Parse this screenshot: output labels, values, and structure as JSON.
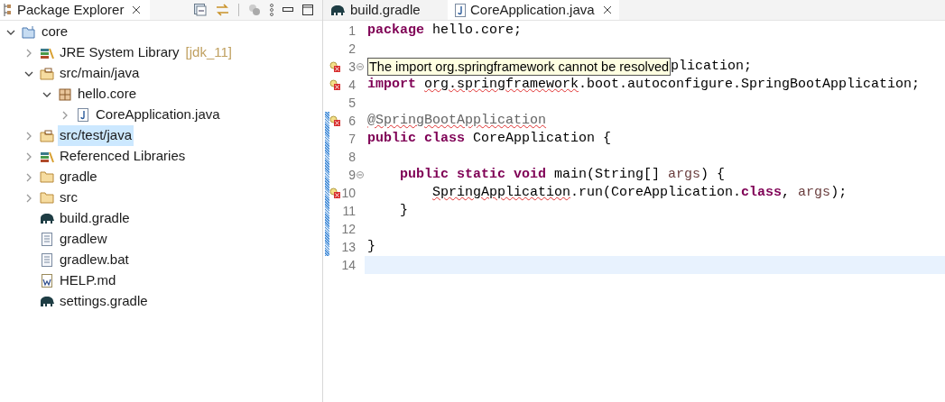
{
  "explorer": {
    "title": "Package Explorer",
    "tree": [
      {
        "label": "core",
        "kind": "project",
        "expanded": true,
        "selected": false,
        "children": [
          {
            "label": "JRE System Library",
            "decoration": "[jdk_11]",
            "kind": "library",
            "expanded": false,
            "selected": false
          },
          {
            "label": "src/main/java",
            "kind": "source-folder",
            "expanded": true,
            "selected": false,
            "children": [
              {
                "label": "hello.core",
                "kind": "package",
                "expanded": true,
                "selected": false,
                "children": [
                  {
                    "label": "CoreApplication.java",
                    "kind": "java-file",
                    "expanded": false,
                    "selected": false
                  }
                ]
              }
            ]
          },
          {
            "label": "src/test/java",
            "kind": "source-folder",
            "expanded": false,
            "selected": true
          },
          {
            "label": "Referenced Libraries",
            "kind": "library",
            "expanded": false,
            "selected": false
          },
          {
            "label": "gradle",
            "kind": "folder",
            "expanded": false,
            "selected": false
          },
          {
            "label": "src",
            "kind": "folder",
            "expanded": false,
            "selected": false
          },
          {
            "label": "build.gradle",
            "kind": "gradle-file",
            "selected": false
          },
          {
            "label": "gradlew",
            "kind": "text-file",
            "selected": false
          },
          {
            "label": "gradlew.bat",
            "kind": "text-file",
            "selected": false
          },
          {
            "label": "HELP.md",
            "kind": "word-file",
            "selected": false
          },
          {
            "label": "settings.gradle",
            "kind": "gradle-file",
            "selected": false
          }
        ]
      }
    ]
  },
  "editor": {
    "tabs": [
      {
        "label": "build.gradle",
        "kind": "gradle-file",
        "selected": false
      },
      {
        "label": "CoreApplication.java",
        "kind": "java-file",
        "selected": true
      }
    ],
    "lines": [
      {
        "number": "1",
        "error": false,
        "fold": false,
        "changed": false,
        "current": false,
        "tokens": [
          {
            "kind": "keyword",
            "text": "package"
          },
          {
            "kind": "text",
            "text": " hello.core;"
          }
        ]
      },
      {
        "number": "2",
        "error": false,
        "fold": false,
        "changed": false,
        "current": false
      },
      {
        "number": "3",
        "error": true,
        "fold": true,
        "changed": false,
        "current": false,
        "tooltip": "The import org.springframework cannot be resolved",
        "tokens": [
          {
            "kind": "text",
            "text": "plication;"
          }
        ]
      },
      {
        "number": "4",
        "error": true,
        "fold": false,
        "changed": false,
        "current": false,
        "tokens": [
          {
            "kind": "keyword",
            "text": "import"
          },
          {
            "kind": "text",
            "text": " org.springframework",
            "squiggle": true
          },
          {
            "kind": "text",
            "text": ".boot.autoconfigure.SpringBootApplication;"
          }
        ]
      },
      {
        "number": "5",
        "error": false,
        "fold": false,
        "changed": false,
        "current": false
      },
      {
        "number": "6",
        "error": true,
        "fold": false,
        "changed": true,
        "current": false,
        "tokens": [
          {
            "kind": "annotation",
            "text": "@SpringBootApplication",
            "squiggle": true
          }
        ]
      },
      {
        "number": "7",
        "error": false,
        "fold": false,
        "changed": true,
        "current": false,
        "tokens": [
          {
            "kind": "keyword",
            "text": "public class"
          },
          {
            "kind": "text",
            "text": " CoreApplication {"
          }
        ]
      },
      {
        "number": "8",
        "error": false,
        "fold": false,
        "changed": true,
        "current": false
      },
      {
        "number": "9",
        "error": false,
        "fold": true,
        "changed": true,
        "current": false,
        "tokens": [
          {
            "kind": "keyword",
            "text": "    public static void"
          },
          {
            "kind": "text",
            "text": " main(String[] "
          },
          {
            "kind": "param",
            "text": "args"
          },
          {
            "kind": "text",
            "text": ") {"
          }
        ]
      },
      {
        "number": "10",
        "error": true,
        "fold": false,
        "changed": true,
        "current": false,
        "tokens": [
          {
            "kind": "text",
            "text": "        SpringApplication",
            "squiggle": true
          },
          {
            "kind": "text",
            "text": ".run(CoreApplication."
          },
          {
            "kind": "keyword",
            "text": "class"
          },
          {
            "kind": "text",
            "text": ", "
          },
          {
            "kind": "param",
            "text": "args"
          },
          {
            "kind": "text",
            "text": ");"
          }
        ]
      },
      {
        "number": "11",
        "error": false,
        "fold": false,
        "changed": true,
        "current": false,
        "tokens": [
          {
            "kind": "text",
            "text": "    }"
          }
        ]
      },
      {
        "number": "12",
        "error": false,
        "fold": false,
        "changed": true,
        "current": false
      },
      {
        "number": "13",
        "error": false,
        "fold": false,
        "changed": true,
        "current": false,
        "tokens": [
          {
            "kind": "text",
            "text": "}"
          }
        ]
      },
      {
        "number": "14",
        "error": false,
        "fold": false,
        "changed": false,
        "current": true
      }
    ]
  }
}
